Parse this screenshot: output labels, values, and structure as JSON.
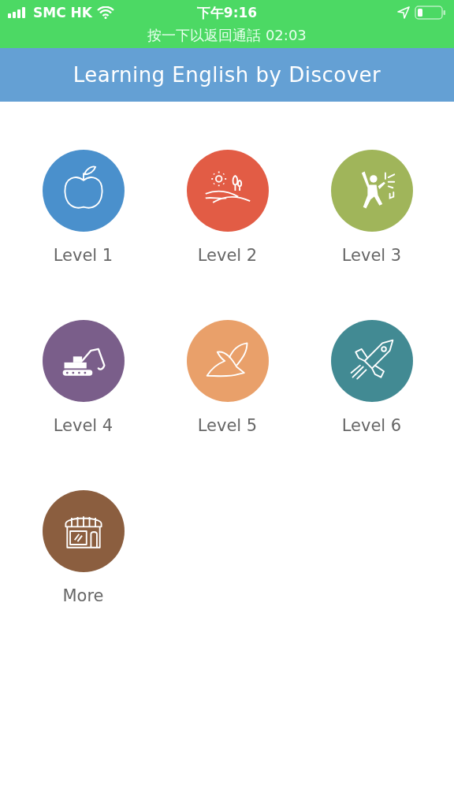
{
  "status_bar": {
    "carrier": "SMC HK",
    "time": "下午9:16",
    "call_banner": "按一下以返回通話 02:03"
  },
  "header": {
    "title": "Learning English by Discover"
  },
  "levels": [
    {
      "label": "Level 1",
      "color": "#4a90cc"
    },
    {
      "label": "Level 2",
      "color": "#e25c45"
    },
    {
      "label": "Level 3",
      "color": "#a0b55a"
    },
    {
      "label": "Level 4",
      "color": "#7a5e8a"
    },
    {
      "label": "Level 5",
      "color": "#e9a06a"
    },
    {
      "label": "Level 6",
      "color": "#428a93"
    },
    {
      "label": "More",
      "color": "#8b5e3f"
    }
  ]
}
